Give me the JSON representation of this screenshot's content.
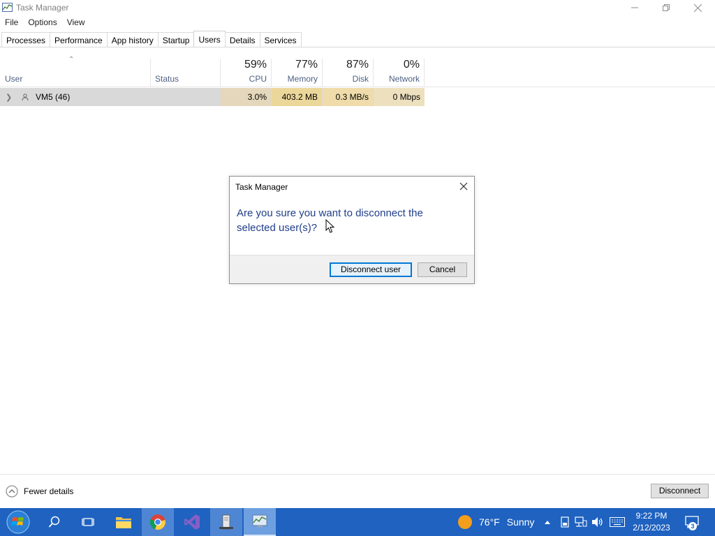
{
  "window": {
    "title": "Task Manager",
    "icon": "task-manager-icon"
  },
  "menu": [
    "File",
    "Options",
    "View"
  ],
  "tabs": [
    {
      "label": "Processes",
      "active": false
    },
    {
      "label": "Performance",
      "active": false
    },
    {
      "label": "App history",
      "active": false
    },
    {
      "label": "Startup",
      "active": false
    },
    {
      "label": "Users",
      "active": true
    },
    {
      "label": "Details",
      "active": false
    },
    {
      "label": "Services",
      "active": false
    }
  ],
  "columns": {
    "user": "User",
    "status": "Status",
    "cpu": {
      "percent": "59%",
      "label": "CPU"
    },
    "memory": {
      "percent": "77%",
      "label": "Memory"
    },
    "disk": {
      "percent": "87%",
      "label": "Disk"
    },
    "network": {
      "percent": "0%",
      "label": "Network"
    }
  },
  "rows": [
    {
      "user": "VM5 (46)",
      "status": "",
      "cpu": "3.0%",
      "memory": "403.2 MB",
      "disk": "0.3 MB/s",
      "network": "0 Mbps"
    }
  ],
  "dialog": {
    "title": "Task Manager",
    "message": "Are you sure you want to disconnect the selected user(s)?",
    "confirm_label": "Disconnect user",
    "cancel_label": "Cancel"
  },
  "footer": {
    "fewer_details": "Fewer details",
    "disconnect_label": "Disconnect"
  },
  "taskbar": {
    "weather": {
      "temp": "76°F",
      "condition": "Sunny"
    },
    "time": "9:22 PM",
    "date": "2/12/2023",
    "notification_count": "3",
    "colors": {
      "bar": "#1f62c0",
      "active": "#4f86d4"
    }
  }
}
